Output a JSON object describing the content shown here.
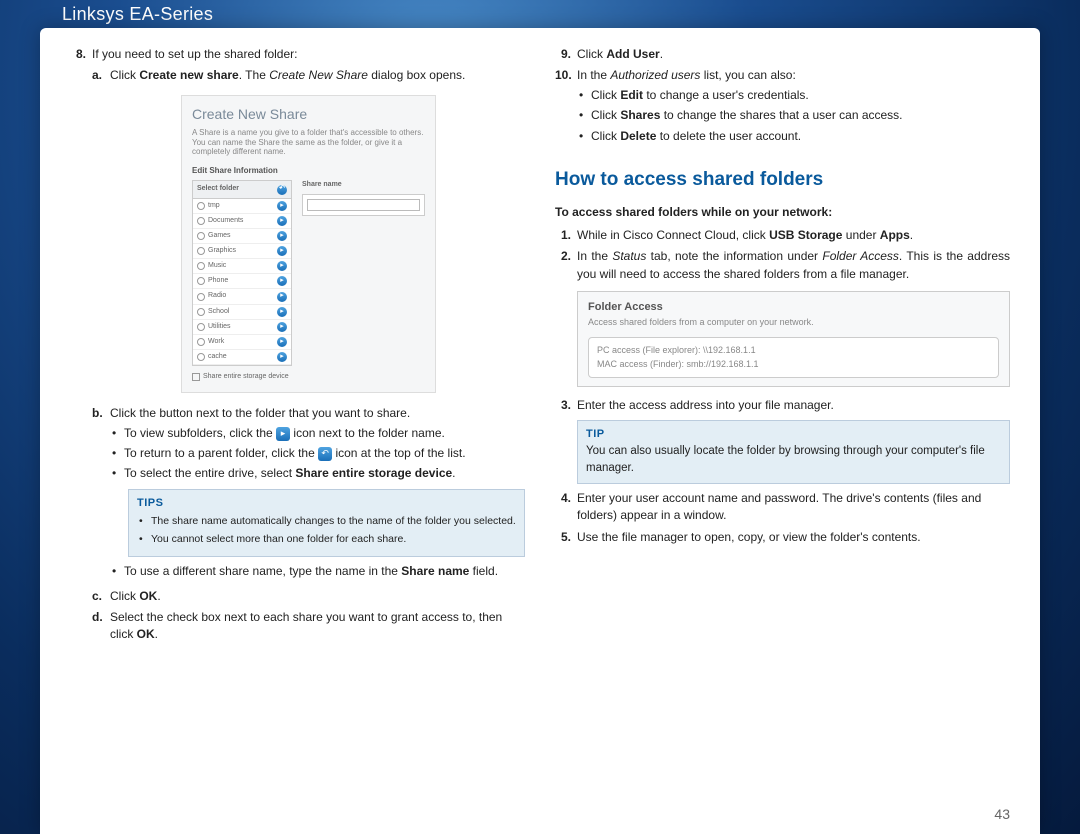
{
  "header": "Linksys EA-Series",
  "page_number": "43",
  "left": {
    "step8": {
      "num": "8.",
      "text": "If you need to set up the shared folder:",
      "a": {
        "num": "a.",
        "pre": "Click ",
        "bold": "Create new share",
        "post": ". The ",
        "italic": "Create New Share",
        "after": " dialog box opens."
      },
      "b": {
        "num": "b.",
        "text": "Click the button next to the folder that you want to share.",
        "bullets": {
          "b1_pre": "To view subfolders, click the ",
          "b1_post": " icon next to the folder name.",
          "b2_pre": "To return to a parent folder, click the ",
          "b2_post": " icon at the top of the list.",
          "b3_pre": "To select the entire drive, select ",
          "b3_bold": "Share entire storage device",
          "b3_post": "."
        }
      },
      "tips": {
        "title": "TIPS",
        "t1": "The share name automatically changes to the name of the folder you selected.",
        "t2": "You cannot select more than one folder for each share."
      },
      "after_tips": {
        "pre": "To use a different share name, type the name in the ",
        "bold": "Share name",
        "post": " field."
      },
      "c": {
        "num": "c.",
        "pre": "Click ",
        "bold": "OK",
        "post": "."
      },
      "d": {
        "num": "d.",
        "pre": "Select the check box next to each share you want to grant access to, then click ",
        "bold": "OK",
        "post": "."
      }
    },
    "dialog": {
      "title": "Create New Share",
      "sub": "A Share is a name you give to a folder that's accessible to others. You can name the Share the same as the folder, or give it a completely different name.",
      "edit_label": "Edit Share Information",
      "select_folder": "Select folder",
      "share_name": "Share name",
      "rows": [
        "tmp",
        "Documents",
        "Games",
        "Graphics",
        "Music",
        "Phone",
        "Radio",
        "School",
        "Utilities",
        "Work",
        "cache"
      ],
      "checkbox": "Share entire storage device"
    }
  },
  "right": {
    "step9": {
      "num": "9.",
      "pre": "Click ",
      "bold": "Add User",
      "post": "."
    },
    "step10": {
      "num": "10.",
      "pre": "In the ",
      "italic": "Authorized users",
      "post": " list, you can also:",
      "b1_pre": "Click ",
      "b1_bold": "Edit",
      "b1_post": " to change a user's credentials.",
      "b2_pre": "Click ",
      "b2_bold": "Shares",
      "b2_post": " to change the shares that a user can access.",
      "b3_pre": "Click ",
      "b3_bold": "Delete",
      "b3_post": " to delete the user account."
    },
    "heading": "How to access shared folders",
    "intro": "To access shared folders while on your network:",
    "s1": {
      "num": "1.",
      "pre": "While in Cisco Connect Cloud, click ",
      "bold": "USB Storage",
      "mid": " under ",
      "bold2": "Apps",
      "post": "."
    },
    "s2": {
      "num": "2.",
      "pre": "In the ",
      "italic": "Status",
      "mid": " tab, note the information under ",
      "italic2": "Folder Access",
      "post": ". This is the address you will need to access the shared folders from a file manager."
    },
    "folder_access": {
      "title": "Folder Access",
      "sub": "Access shared folders from a computer on your network.",
      "pc": "PC access (File explorer): \\\\192.168.1.1",
      "mac": "MAC access (Finder): smb://192.168.1.1"
    },
    "s3": {
      "num": "3.",
      "text": "Enter the access address into your file manager."
    },
    "tip": {
      "title": "TIP",
      "text": "You can also usually locate the folder by browsing through your computer's file manager."
    },
    "s4": {
      "num": "4.",
      "text": "Enter your user account name and password. The drive's contents (files and folders) appear in a window."
    },
    "s5": {
      "num": "5.",
      "text": "Use the file manager to open, copy, or view the folder's contents."
    }
  }
}
